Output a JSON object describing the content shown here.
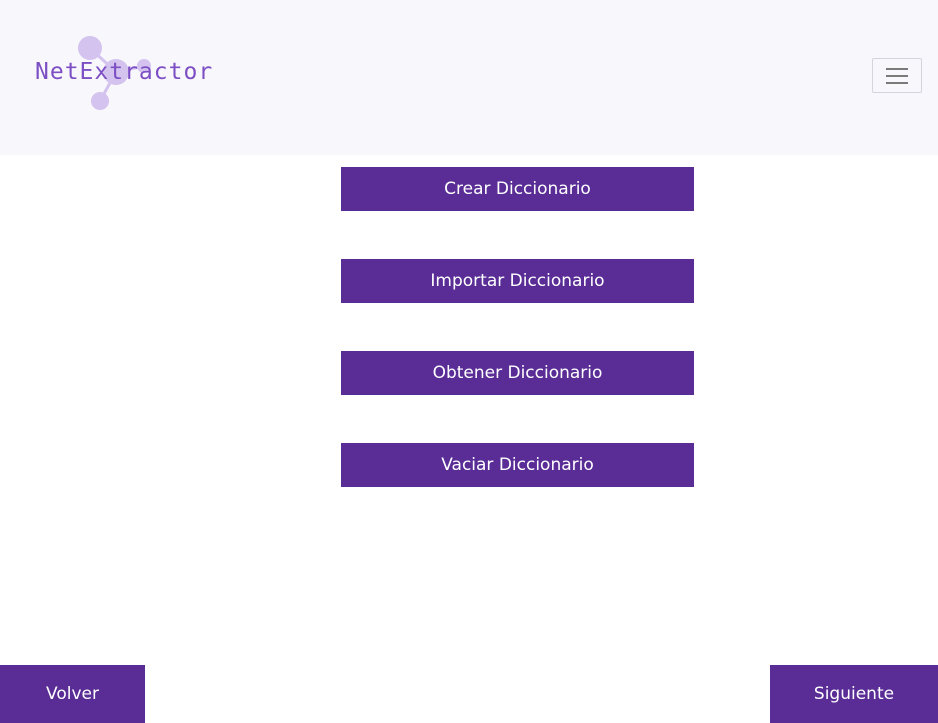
{
  "header": {
    "logo_text": "NetExtractor",
    "menu_icon": "hamburger-menu-icon"
  },
  "actions": {
    "crear": "Crear Diccionario",
    "importar": "Importar Diccionario",
    "obtener": "Obtener Diccionario",
    "vaciar": "Vaciar Diccionario"
  },
  "footer": {
    "back": "Volver",
    "next": "Siguiente"
  },
  "colors": {
    "primary": "#5a2d96",
    "header_bg": "#f8f7fc",
    "logo_text": "#7d4fc4",
    "logo_molecule": "#d3c3ee"
  }
}
